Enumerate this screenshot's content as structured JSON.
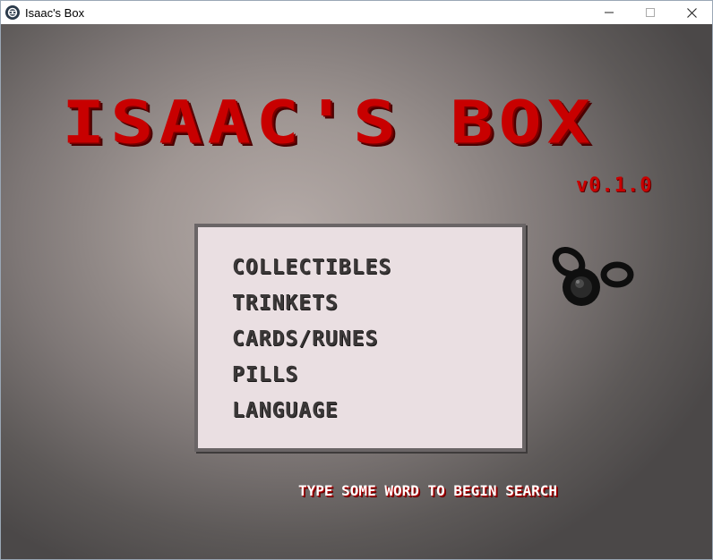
{
  "window": {
    "title": "Isaac's Box",
    "controls": {
      "minimize_icon": "minimize-icon",
      "maximize_icon": "maximize-icon",
      "close_icon": "close-icon"
    }
  },
  "header": {
    "logo_text": "ISAAC'S BOX",
    "version": "v0.1.0"
  },
  "menu": {
    "items": [
      {
        "label": "COLLECTIBLES"
      },
      {
        "label": "TRINKETS"
      },
      {
        "label": "CARDS/RUNES"
      },
      {
        "label": "PILLS"
      },
      {
        "label": "LANGUAGE"
      }
    ]
  },
  "footer": {
    "hint": "TYPE SOME WORD TO BEGIN SEARCH"
  },
  "colors": {
    "logo_red": "#c80000",
    "panel_bg": "#eadfe2",
    "menu_text": "#3b3838"
  },
  "decoration": {
    "icon": "bomb-icon"
  }
}
